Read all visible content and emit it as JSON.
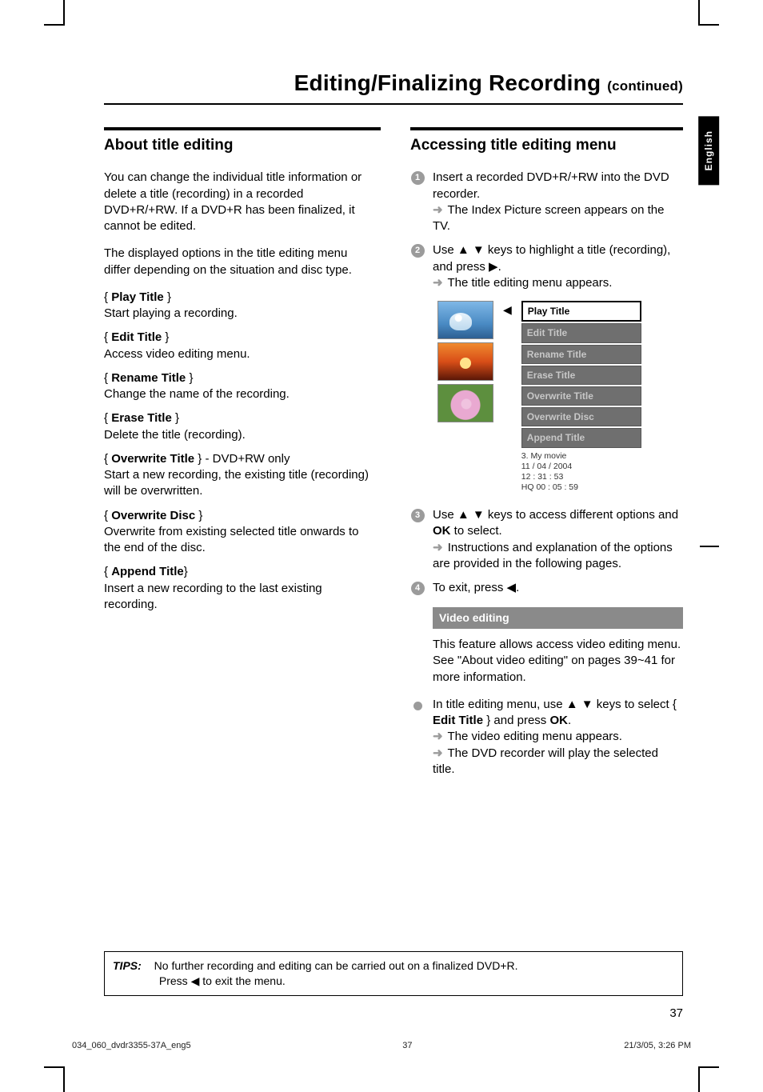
{
  "page": {
    "heading": "Editing/Finalizing Recording",
    "heading_suffix": "(continued)",
    "language_tab": "English",
    "page_number": "37"
  },
  "left": {
    "section_title": "About title editing",
    "intro_1": "You can change the individual title information or delete a title (recording) in a recorded DVD+R/+RW.  If a DVD+R has been finalized, it cannot be edited.",
    "intro_2": "The displayed options in the title editing menu differ depending on the situation and disc type.",
    "options": [
      {
        "label": "Play Title",
        "suffix": "",
        "desc": "Start playing a recording."
      },
      {
        "label": "Edit Title",
        "suffix": "",
        "desc": "Access video editing menu."
      },
      {
        "label": "Rename Title",
        "suffix": "",
        "desc": "Change the name of the recording."
      },
      {
        "label": "Erase Title",
        "suffix": "",
        "desc": "Delete the title (recording)."
      },
      {
        "label": "Overwrite Title",
        "suffix": " - DVD+RW only",
        "desc": "Start a new recording, the existing title (recording) will be overwritten."
      },
      {
        "label": "Overwrite Disc",
        "suffix": "",
        "desc": "Overwrite from existing selected title onwards to the end of the disc."
      },
      {
        "label": "Append Title",
        "suffix": "",
        "desc": "Insert a new recording to the last existing recording."
      }
    ]
  },
  "right": {
    "section_title": "Accessing title editing menu",
    "step1": {
      "num": "1",
      "text_1": "Insert a recorded DVD+R/+RW into the DVD recorder.",
      "res_1": "The Index Picture screen appears on the TV."
    },
    "step2": {
      "num": "2",
      "line_a_pre": "Use ",
      "line_a_post": " keys to highlight a title (recording), and press ",
      "res": "The title editing menu appears."
    },
    "menu": {
      "items": [
        "Play Title",
        "Edit Title",
        "Rename Title",
        "Erase Title",
        "Overwrite Title",
        "Overwrite Disc",
        "Append Title"
      ],
      "meta_1": "3. My movie",
      "meta_2": "11 / 04 / 2004",
      "meta_3": "12 : 31 : 53",
      "meta_4": "HQ 00 : 05 : 59"
    },
    "step3": {
      "num": "3",
      "line_pre": "Use ",
      "line_mid": " keys to access different options and ",
      "line_post": " to select.",
      "ok": "OK",
      "res": "Instructions and explanation of the options are provided in the following pages."
    },
    "step4": {
      "num": "4",
      "text": "To exit, press "
    },
    "sub": {
      "heading": "Video editing",
      "body": "This feature allows access video editing menu. See \"About video editing\" on pages 39~41 for more information.",
      "bullet_pre": "In title editing menu, use ",
      "bullet_mid": " keys to select { ",
      "bullet_label": "Edit Title",
      "bullet_post": " } and press ",
      "ok": "OK",
      "res_1": "The video editing menu appears.",
      "res_2": "The DVD recorder will play the selected title."
    }
  },
  "tips": {
    "label": "TIPS:",
    "line1": "No further recording and editing can be carried out on a finalized DVD+R.",
    "line2_pre": "Press ",
    "line2_post": " to exit the menu."
  },
  "footer": {
    "left": "034_060_dvdr3355-37A_eng5",
    "mid": "37",
    "right": "21/3/05, 3:26 PM"
  }
}
